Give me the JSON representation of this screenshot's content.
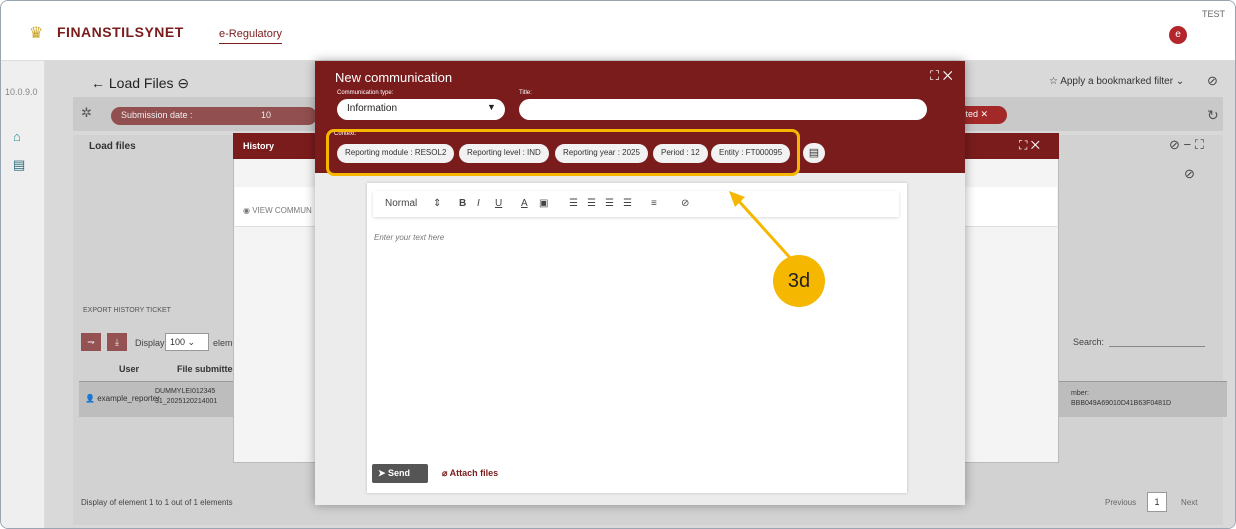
{
  "header": {
    "brand": "Finanstilsynet",
    "brand_icon": "crown-icon",
    "nav_link": "e-Regulatory",
    "env_label": "TEST",
    "avatar_letter": "e"
  },
  "rail": {
    "version": "10.0.9.0",
    "items": [
      {
        "icon": "home-icon",
        "glyph": "⌂"
      },
      {
        "icon": "message-icon",
        "glyph": "▤"
      }
    ]
  },
  "page": {
    "title": "← Load Files ⊖",
    "bookmark_label": "Apply a bookmarked filter",
    "filter_pill": "Submission date :",
    "filter_pill_value": "10",
    "filter_pill_right": "cted",
    "panel_label": "Load files",
    "toolbar": "EXPORT   HISTORY   TICKET",
    "display_label": "Display",
    "display_value": "100",
    "display_suffix": "element",
    "search_label": "Search:",
    "columns": {
      "user": "User",
      "file": "File submitted"
    },
    "row": {
      "user": "example_reporter",
      "file_line1": "DUMMYLEI012345",
      "file_line2": "31_2025120214001",
      "hash_line1": "mber:",
      "hash_line2": "BBB049A69010D41B63F0481D"
    },
    "display_info": "Display of element 1 to 1 out of 1 elements",
    "pager": {
      "prev": "Previous",
      "page": "1",
      "next": "Next"
    }
  },
  "history": {
    "title": "History",
    "view_comm": "VIEW COMMUN"
  },
  "modal": {
    "title": "New communication",
    "comm_type_label": "Communication type:",
    "comm_type_value": "Information",
    "title_label": "Title:",
    "title_value": "",
    "context_label": "Context:",
    "chips": [
      "Reporting module : RESOL2",
      "Reporting level : IND",
      "Reporting year : 2025",
      "Period : 12",
      "Entity : FT000095"
    ],
    "editor": {
      "format": "Normal",
      "placeholder": "Enter your text here"
    },
    "send_label": "Send",
    "attach_label": "Attach files"
  },
  "callout": {
    "label": "3d",
    "color": "#f5b700"
  },
  "colors": {
    "brand": "#7a1c1c",
    "highlight": "#f5b700"
  }
}
